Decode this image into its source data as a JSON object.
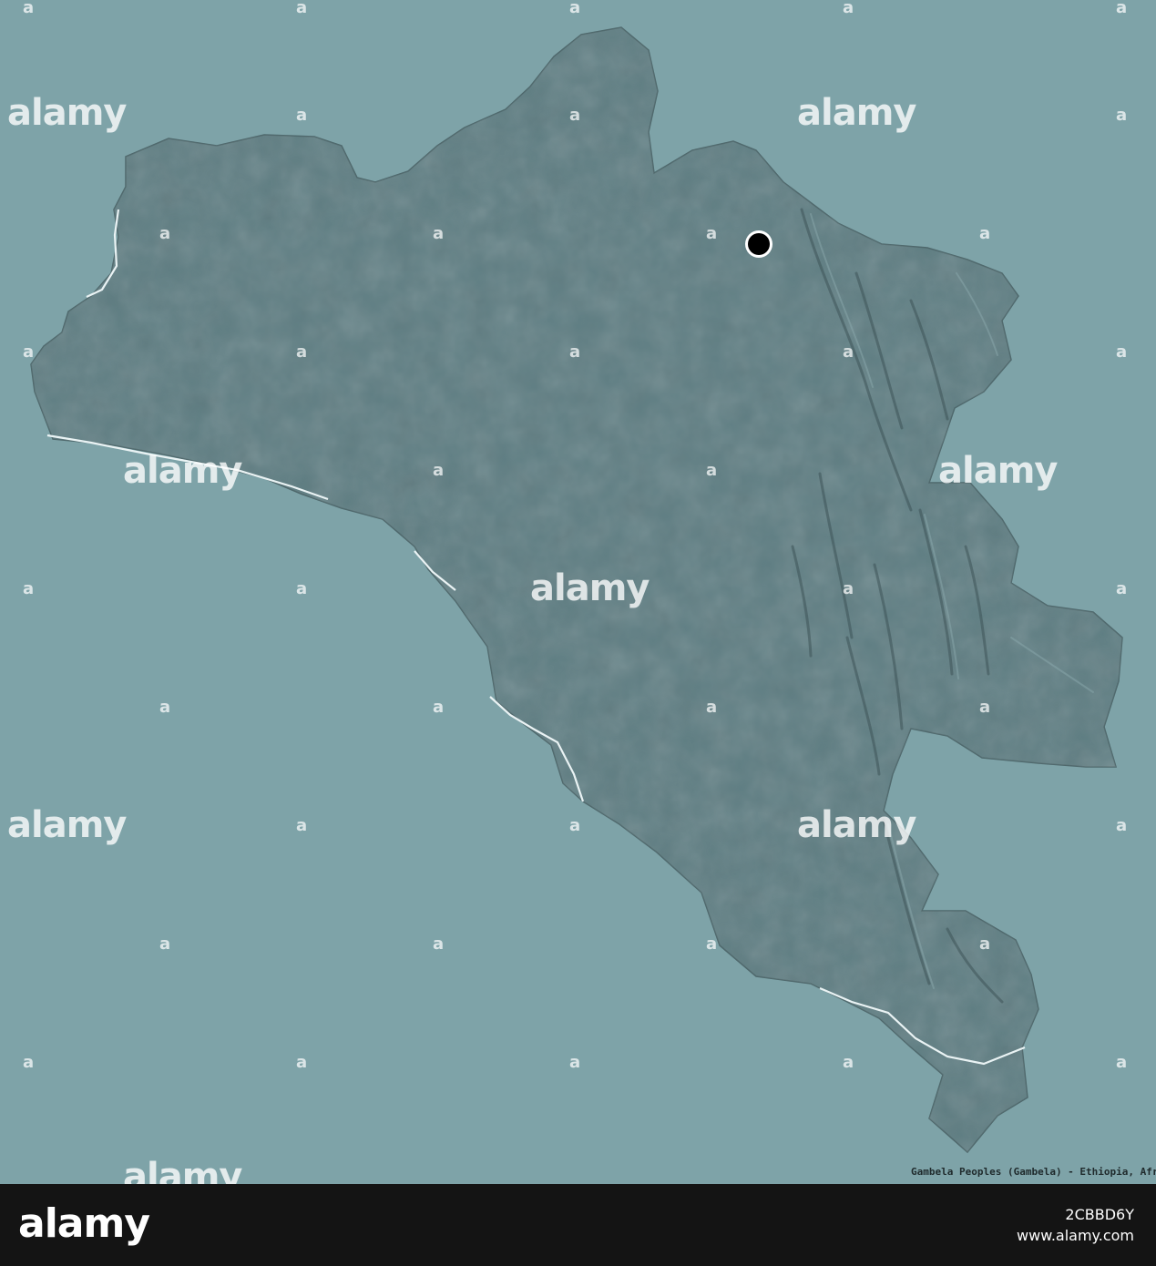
{
  "map": {
    "caption": "Gambela Peoples (Gambela) - Ethiopia, Africa",
    "colors": {
      "background": "#7ea3a8",
      "region_fill": "#5f7e83",
      "region_relief_shadow": "#3e5458",
      "region_relief_highlight": "#8aa7ab",
      "border_line": "#eaf3f4",
      "capital_marker": "#000000"
    },
    "marker": {
      "type": "capital",
      "icon": "black-dot-white-ring"
    }
  },
  "watermark": {
    "text": "alamy",
    "mark_glyph": "a"
  },
  "footer": {
    "logo": "alamy",
    "image_id": "2CBBD6Y",
    "url": "www.alamy.com",
    "background": "#141414"
  }
}
